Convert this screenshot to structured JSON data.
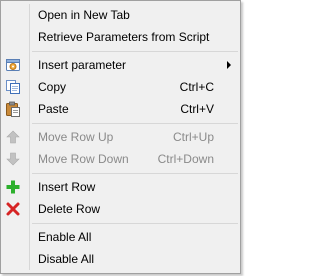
{
  "menu": {
    "items": [
      {
        "label": "Open in New Tab"
      },
      {
        "label": "Retrieve Parameters from Script"
      },
      {
        "label": "Insert parameter",
        "icon": "insert-parameter-icon"
      },
      {
        "label": "Copy",
        "shortcut": "Ctrl+C",
        "icon": "copy-icon"
      },
      {
        "label": "Paste",
        "shortcut": "Ctrl+V",
        "icon": "paste-icon"
      },
      {
        "label": "Move Row Up",
        "shortcut": "Ctrl+Up",
        "icon": "arrow-up-icon",
        "disabled": true
      },
      {
        "label": "Move Row Down",
        "shortcut": "Ctrl+Down",
        "icon": "arrow-down-icon",
        "disabled": true
      },
      {
        "label": "Insert Row",
        "icon": "plus-icon"
      },
      {
        "label": "Delete Row",
        "icon": "delete-icon"
      },
      {
        "label": "Enable All"
      },
      {
        "label": "Disable All"
      }
    ]
  },
  "colors": {
    "background": "#f0f0f0",
    "border": "#a0a0a0",
    "separator": "#d7d7d7",
    "disabled_text": "#8a8a8a",
    "plus_green": "#2db02d",
    "delete_red": "#d62424"
  }
}
